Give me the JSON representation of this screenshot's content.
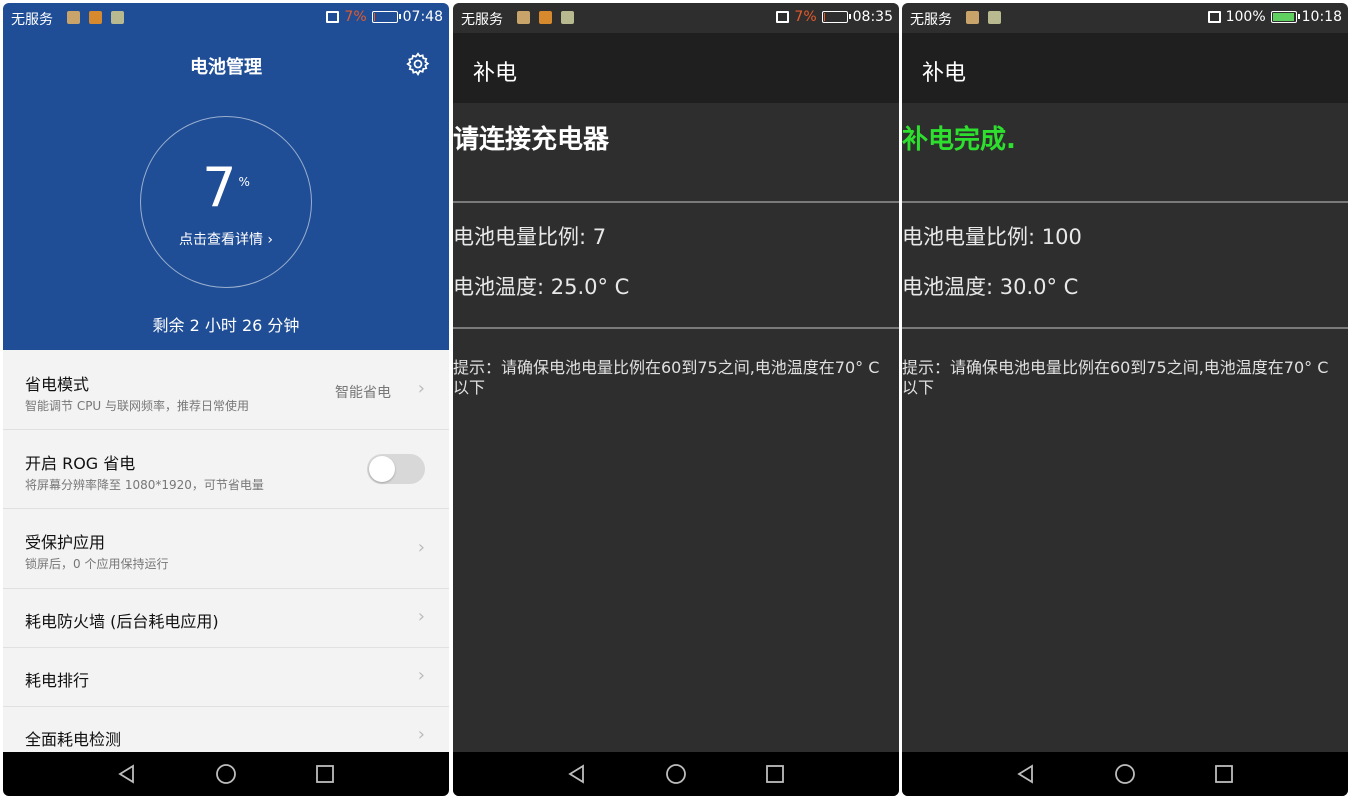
{
  "phones": [
    {
      "status": {
        "carrier": "无服务",
        "battery_pct": "7%",
        "battery_level": 0.07,
        "time": "07:48"
      },
      "title": "电池管理",
      "battery_number": "7",
      "battery_unit": "%",
      "details_link": "点击查看详情 ›",
      "remaining": "剩余 2 小时 26 分钟",
      "items": [
        {
          "title": "省电模式",
          "subtitle": "智能调节 CPU 与联网频率，推荐日常使用",
          "value": "智能省电"
        },
        {
          "title": "开启 ROG 省电",
          "subtitle": "将屏幕分辨率降至 1080*1920，可节省电量",
          "toggle": false
        },
        {
          "title": "受保护应用",
          "subtitle": "锁屏后，0 个应用保持运行"
        },
        {
          "title": "耗电防火墙 (后台耗电应用)"
        },
        {
          "title": "耗电排行"
        },
        {
          "title": "全面耗电检测"
        }
      ]
    },
    {
      "status": {
        "carrier": "无服务",
        "battery_pct": "7%",
        "battery_level": 0.07,
        "time": "08:35"
      },
      "title": "补电",
      "message": "请连接充电器",
      "level_label": "电池电量比例:  7",
      "temp_label": "电池温度: 25.0° C",
      "hint": "提示：请确保电池电量比例在60到75之间,电池温度在70° C以下"
    },
    {
      "status": {
        "carrier": "无服务",
        "battery_pct": "100%",
        "battery_level": 1.0,
        "time": "10:18"
      },
      "title": "补电",
      "message": "补电完成.",
      "level_label": "电池电量比例:  100",
      "temp_label": "电池温度: 30.0° C",
      "hint": "提示：请确保电池电量比例在60到75之间,电池温度在70° C以下"
    }
  ],
  "colors": {
    "header_blue": "#1f4e96",
    "success_green": "#2ee02e",
    "low_battery": "#e25b2c",
    "dark_bg": "#2e2e2e"
  },
  "icons": [
    "gear-icon",
    "chevron-right-icon",
    "back-nav-icon",
    "home-nav-icon",
    "recents-nav-icon",
    "battery-icon",
    "sim-icon"
  ]
}
